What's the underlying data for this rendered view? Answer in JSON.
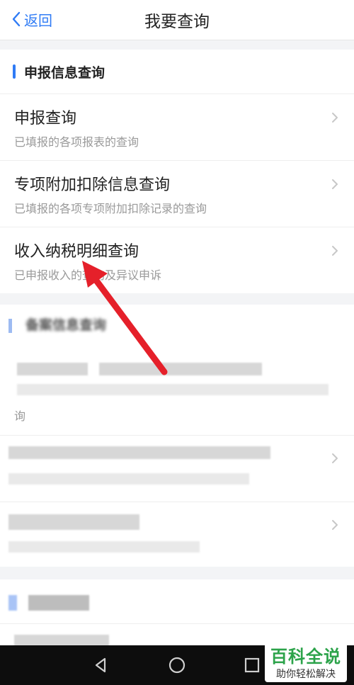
{
  "header": {
    "back_label": "返回",
    "title": "我要查询"
  },
  "section1": {
    "title": "申报信息查询",
    "items": [
      {
        "title": "申报查询",
        "subtitle": "已填报的各项报表的查询"
      },
      {
        "title": "专项附加扣除信息查询",
        "subtitle": "已填报的各项专项附加扣除记录的查询"
      },
      {
        "title": "收入纳税明细查询",
        "subtitle": "已申报收入的查询及异议申诉"
      }
    ]
  },
  "section2": {
    "title": "备案信息查询",
    "row1_tail": "询"
  },
  "watermark": {
    "title": "百科全说",
    "subtitle": "助你轻松解决"
  },
  "colors": {
    "accent": "#2f7bf5",
    "arrow": "#e5202a",
    "watermark_green": "#2ca34a"
  }
}
